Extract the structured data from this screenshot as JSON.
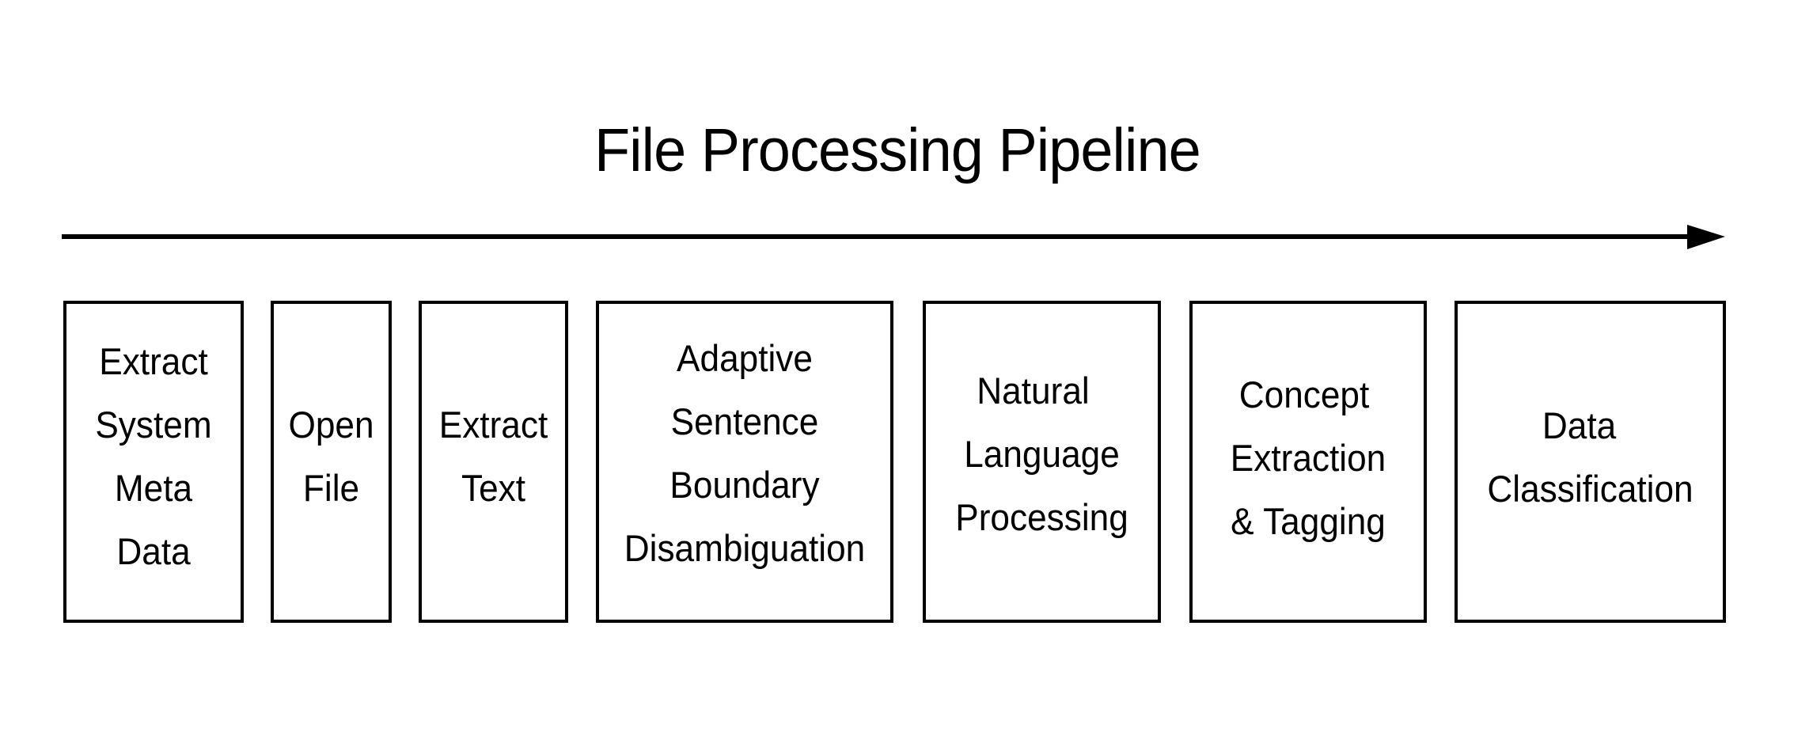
{
  "title": "File Processing Pipeline",
  "flow_direction": "left-to-right",
  "colors": {
    "stroke": "#000000",
    "background": "#ffffff",
    "text": "#000000"
  },
  "stages": [
    {
      "id": "extract-metadata",
      "lines": [
        "Extract",
        "System",
        "Meta",
        "Data"
      ]
    },
    {
      "id": "open-file",
      "lines": [
        "Open",
        "File"
      ]
    },
    {
      "id": "extract-text",
      "lines": [
        "Extract",
        "Text"
      ]
    },
    {
      "id": "sentence-boundary",
      "lines": [
        "Adaptive",
        "Sentence",
        "Boundary",
        "Disambiguation"
      ]
    },
    {
      "id": "nlp",
      "lines": [
        "Natural",
        "Language",
        "Processing"
      ]
    },
    {
      "id": "concept-extraction",
      "lines": [
        "Concept",
        "Extraction",
        "& Tagging"
      ]
    },
    {
      "id": "data-classification",
      "lines": [
        "Data",
        "Classification"
      ]
    }
  ]
}
